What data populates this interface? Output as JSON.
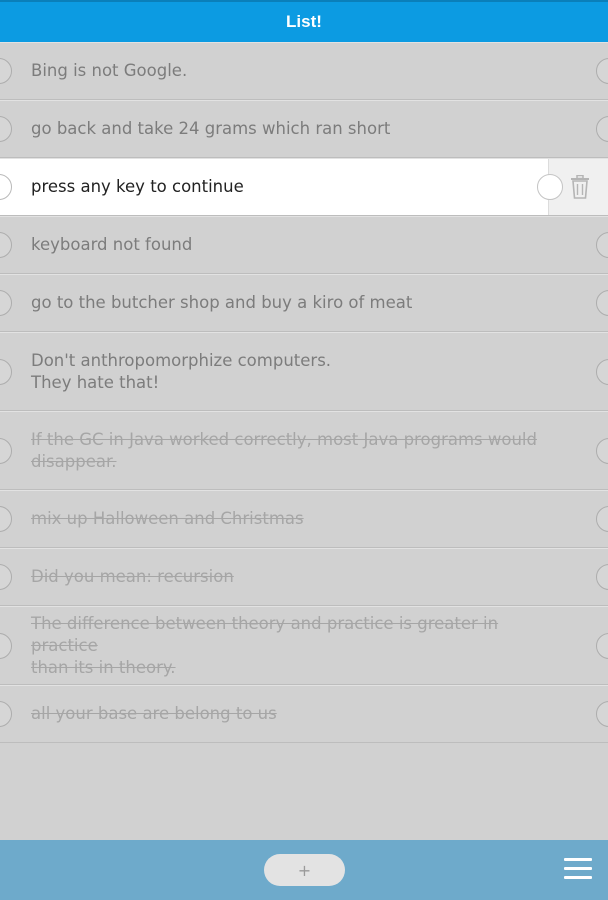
{
  "header": {
    "title": "List!"
  },
  "items": [
    {
      "text": "Bing is not Google.",
      "done": false
    },
    {
      "text": "go back and take 24 grams which ran short",
      "done": false
    },
    {
      "text": "press any key to continue",
      "done": false,
      "active": true
    },
    {
      "text": "keyboard not found",
      "done": false
    },
    {
      "text": "go to the butcher shop and buy a kiro of meat",
      "done": false
    },
    {
      "text": "Don't anthropomorphize computers.\nThey hate that!",
      "done": false
    },
    {
      "text": "If the GC in Java worked correctly, most Java programs would\ndisappear.",
      "done": true
    },
    {
      "text": "mix up Halloween and Christmas",
      "done": true
    },
    {
      "text": "Did you mean: recursion",
      "done": true
    },
    {
      "text": "The difference between theory and practice is greater in practice\nthan its in theory.",
      "done": true
    },
    {
      "text": "all your base are belong to us",
      "done": true
    }
  ],
  "footer": {
    "add_label": "+"
  },
  "icons": {
    "delete": "trash-icon",
    "menu": "menu-icon"
  },
  "colors": {
    "header": "#0c9be2",
    "footer": "#6eaacb",
    "background": "#d1d1d1"
  }
}
